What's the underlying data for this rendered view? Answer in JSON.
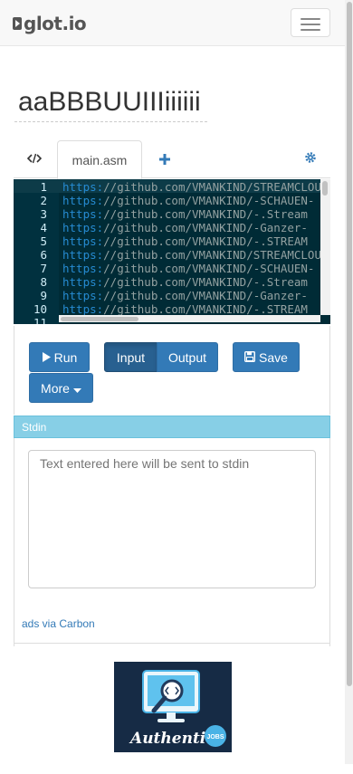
{
  "navbar": {
    "brand": "glot.io",
    "menu_icon": "hamburger-icon"
  },
  "title": "aaBBBUUIIIiiiiii",
  "tabs": [
    {
      "icon": "code-icon"
    },
    {
      "label": "main.asm"
    },
    {
      "icon": "plus-icon"
    },
    {
      "icon": "gear-icon"
    }
  ],
  "editor": {
    "lines": [
      {
        "num": "1",
        "proto": "https:",
        "rest": "//github.com/VMANKIND/STREAMCLOUD"
      },
      {
        "num": "2",
        "proto": "https:",
        "rest": "//github.com/VMANKIND/-SCHAUEN-"
      },
      {
        "num": "3",
        "proto": "https:",
        "rest": "//github.com/VMANKIND/-.Stream"
      },
      {
        "num": "4",
        "proto": "https:",
        "rest": "//github.com/VMANKIND/-Ganzer-"
      },
      {
        "num": "5",
        "proto": "https:",
        "rest": "//github.com/VMANKIND/-.STREAM"
      },
      {
        "num": "6",
        "proto": "https:",
        "rest": "//github.com/VMANKIND/STREAMCLOUD"
      },
      {
        "num": "7",
        "proto": "https:",
        "rest": "//github.com/VMANKIND/-SCHAUEN-"
      },
      {
        "num": "8",
        "proto": "https:",
        "rest": "//github.com/VMANKIND/-.Stream"
      },
      {
        "num": "9",
        "proto": "https:",
        "rest": "//github.com/VMANKIND/-Ganzer-"
      },
      {
        "num": "10",
        "proto": "https:",
        "rest": "//github.com/VMANKIND/-.STREAM"
      },
      {
        "num": "11",
        "proto": "",
        "rest": ""
      }
    ]
  },
  "toolbar": {
    "run_label": "Run",
    "input_label": "Input",
    "output_label": "Output",
    "save_label": "Save",
    "more_label": "More"
  },
  "stdin": {
    "heading": "Stdin",
    "placeholder": "Text entered here will be sent to stdin"
  },
  "ads": {
    "link": "ads via Carbon",
    "ad_text": "Authentic",
    "ad_badge": "JOBS"
  },
  "colors": {
    "primary": "#337ab7",
    "editor_bg": "#002b36",
    "stdin_header": "#87cfe6"
  }
}
